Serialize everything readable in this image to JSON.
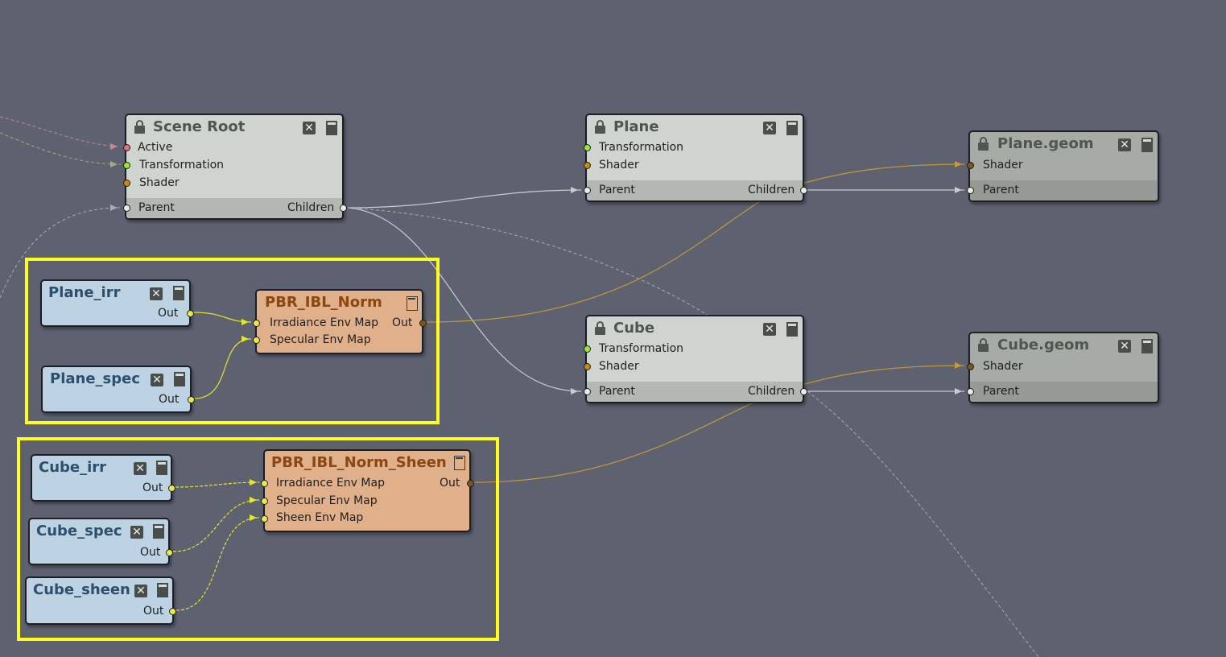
{
  "nodes": {
    "scene_root": {
      "title": "Scene Root",
      "inputs": [
        "Active",
        "Transformation",
        "Shader"
      ],
      "parent": "Parent",
      "children": "Children"
    },
    "plane": {
      "title": "Plane",
      "inputs": [
        "Transformation",
        "Shader"
      ],
      "parent": "Parent",
      "children": "Children"
    },
    "plane_geom": {
      "title": "Plane.geom",
      "inputs": [
        "Shader"
      ],
      "parent": "Parent"
    },
    "cube": {
      "title": "Cube",
      "inputs": [
        "Transformation",
        "Shader"
      ],
      "parent": "Parent",
      "children": "Children"
    },
    "cube_geom": {
      "title": "Cube.geom",
      "inputs": [
        "Shader"
      ],
      "parent": "Parent"
    },
    "plane_irr": {
      "title": "Plane_irr",
      "out": "Out"
    },
    "plane_spec": {
      "title": "Plane_spec",
      "out": "Out"
    },
    "pbr_ibl_norm": {
      "title": "PBR_IBL_Norm",
      "inputs": [
        "Irradiance Env Map",
        "Specular Env Map"
      ],
      "out": "Out"
    },
    "cube_irr": {
      "title": "Cube_irr",
      "out": "Out"
    },
    "cube_spec": {
      "title": "Cube_spec",
      "out": "Out"
    },
    "cube_sheen": {
      "title": "Cube_sheen",
      "out": "Out"
    },
    "pbr_ibl_norm_sheen": {
      "title": "PBR_IBL_Norm_Sheen",
      "inputs": [
        "Irradiance Env Map",
        "Specular Env Map",
        "Sheen Env Map"
      ],
      "out": "Out"
    }
  },
  "colors": {
    "background": "#5d6170",
    "selection": "#ffff1a",
    "wire_shader": "#c49a3a",
    "wire_hierarchy": "#c8cbd0",
    "wire_env": "#e6e62a"
  }
}
